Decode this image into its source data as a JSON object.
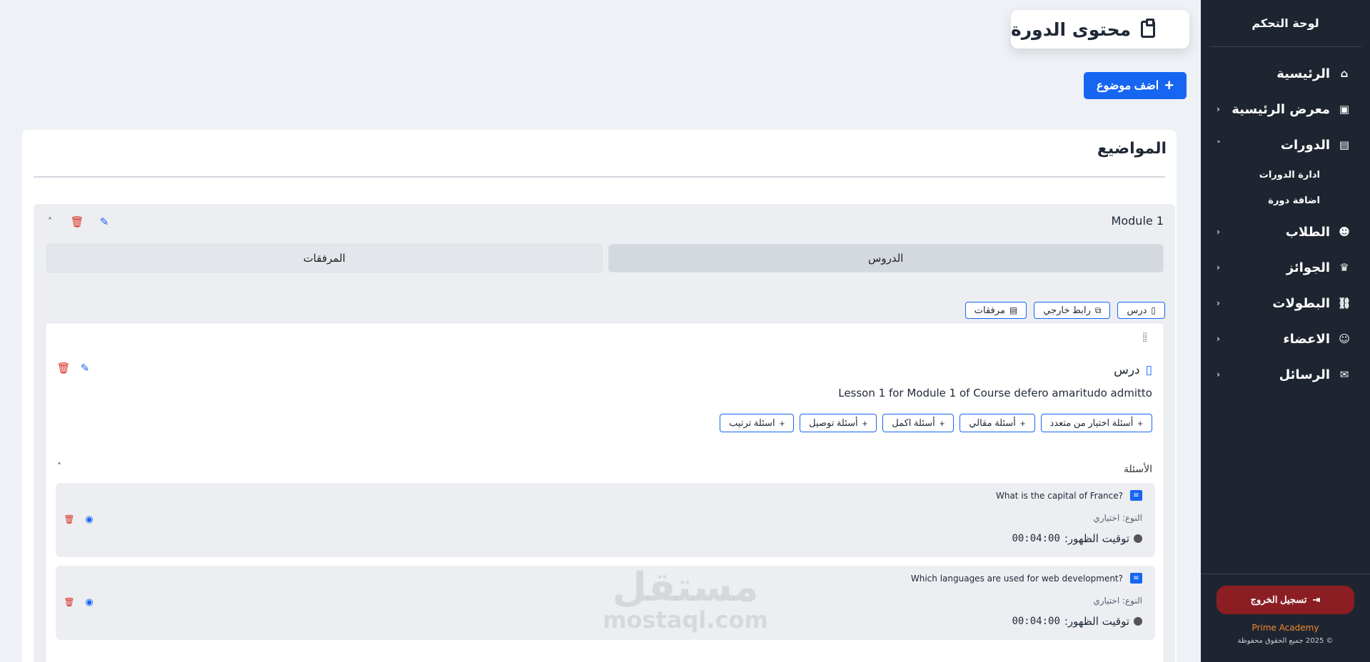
{
  "sidebar": {
    "title": "لوحة التحكم",
    "items": [
      {
        "label": "الرئيسية",
        "icon": "home-icon",
        "glyph": "⌂",
        "chevron": ""
      },
      {
        "label": "معرض الرئيسية",
        "icon": "gallery-icon",
        "glyph": "▣",
        "chevron": "‹"
      },
      {
        "label": "الدورات",
        "icon": "book-icon",
        "glyph": "▤",
        "chevron": "˅"
      },
      {
        "label": "الطلاب",
        "icon": "student-icon",
        "glyph": "☻",
        "chevron": "‹"
      },
      {
        "label": "الجوائز",
        "icon": "trophy-icon",
        "glyph": "♛",
        "chevron": "‹"
      },
      {
        "label": "البطولات",
        "icon": "tournament-icon",
        "glyph": "⛓",
        "chevron": "‹"
      },
      {
        "label": "الاعضاء",
        "icon": "users-icon",
        "glyph": "☺",
        "chevron": "‹"
      },
      {
        "label": "الرسائل",
        "icon": "envelope-icon",
        "glyph": "✉",
        "chevron": "‹"
      }
    ],
    "courses_sub": [
      "ادارة الدورات",
      "اضافة دورة"
    ],
    "logout_label": "تسجيل الخروج",
    "brand": "Prime Academy",
    "copyright": "© 2025 جميع الحقوق محفوظة"
  },
  "header": {
    "title": "محتوى الدورة"
  },
  "add_topic_label": "اضف موضوع",
  "main": {
    "title": "المواضيع",
    "module": {
      "name": "Module 1",
      "tabs": [
        {
          "label": "الدروس",
          "active": true
        },
        {
          "label": "المرفقات",
          "active": false
        }
      ],
      "add_buttons": [
        {
          "label": "درس",
          "icon": "book-icon",
          "glyph": "▯"
        },
        {
          "label": "رابط خارجي",
          "icon": "external-link-icon",
          "glyph": "⧉"
        },
        {
          "label": "مرفقات",
          "icon": "file-icon",
          "glyph": "▤"
        }
      ],
      "lesson": {
        "type_label": "درس",
        "description": "Lesson 1 for Module 1 of Course defero amaritudo admitto",
        "question_buttons": [
          "أسئلة اختيار من متعدد",
          "أسئلة مقالي",
          "أسئلة اكمل",
          "أسئلة توصيل",
          "اسئلة ترتيب"
        ],
        "questions_title": "الأسئلة",
        "questions": [
          {
            "text": "What is the capital of France?",
            "type": "النوع: اختياري",
            "time_label": "توقيت الظهور:",
            "time": "00:04:00"
          },
          {
            "text": "Which languages are used for web development?",
            "type": "النوع: اختياري",
            "time_label": "توقيت الظهور:",
            "time": "00:04:00"
          }
        ]
      }
    }
  },
  "watermark": {
    "ar": "مستقل",
    "en": "mostaql.com"
  },
  "colors": {
    "primary": "#1766f2",
    "sidebar": "#1f2530",
    "logout": "#8b1e23",
    "brand": "#f28b2e",
    "danger": "#d92d20"
  }
}
